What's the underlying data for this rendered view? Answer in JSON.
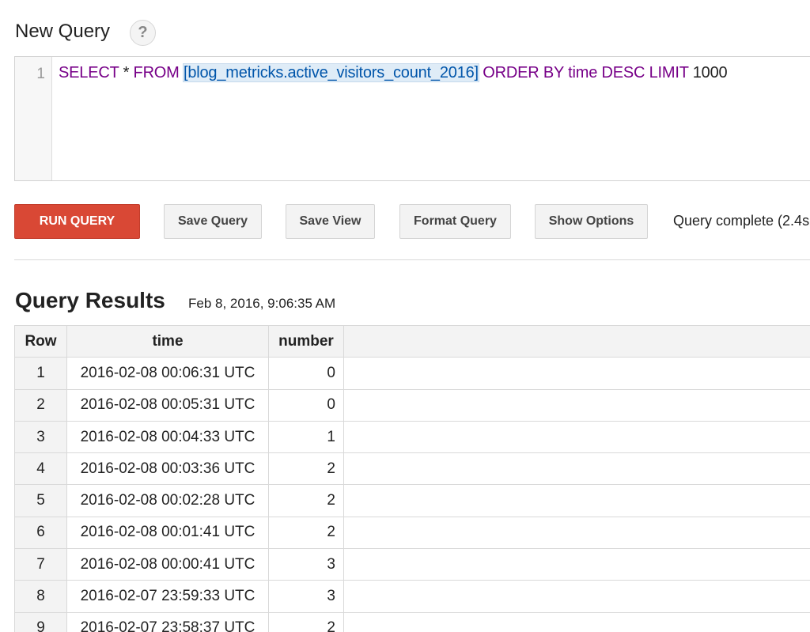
{
  "header": {
    "title": "New Query",
    "help_glyph": "?"
  },
  "editor": {
    "line_number": "1",
    "tokens": {
      "select": "SELECT",
      "star": " * ",
      "from": "FROM",
      "space1": " ",
      "table": "[blog_metricks.active_visitors_count_2016]",
      "space2": " ",
      "order_by": "ORDER BY",
      "space3": " ",
      "time": "time",
      "space4": " ",
      "desc": "DESC",
      "space5": " ",
      "limit": "LIMIT",
      "space6": " ",
      "limit_value": "1000"
    }
  },
  "toolbar": {
    "run_label": "RUN QUERY",
    "save_query_label": "Save Query",
    "save_view_label": "Save View",
    "format_label": "Format Query",
    "options_label": "Show Options",
    "status": "Query complete (2.4s"
  },
  "results": {
    "title": "Query Results",
    "timestamp": "Feb 8, 2016, 9:06:35 AM",
    "columns": {
      "row": "Row",
      "time": "time",
      "number": "number"
    },
    "rows": [
      {
        "row": "1",
        "time": "2016-02-08 00:06:31 UTC",
        "number": "0"
      },
      {
        "row": "2",
        "time": "2016-02-08 00:05:31 UTC",
        "number": "0"
      },
      {
        "row": "3",
        "time": "2016-02-08 00:04:33 UTC",
        "number": "1"
      },
      {
        "row": "4",
        "time": "2016-02-08 00:03:36 UTC",
        "number": "2"
      },
      {
        "row": "5",
        "time": "2016-02-08 00:02:28 UTC",
        "number": "2"
      },
      {
        "row": "6",
        "time": "2016-02-08 00:01:41 UTC",
        "number": "2"
      },
      {
        "row": "7",
        "time": "2016-02-08 00:00:41 UTC",
        "number": "3"
      },
      {
        "row": "8",
        "time": "2016-02-07 23:59:33 UTC",
        "number": "3"
      },
      {
        "row": "9",
        "time": "2016-02-07 23:58:37 UTC",
        "number": "2"
      }
    ]
  },
  "colors": {
    "run_button": "#d94835",
    "keyword": "#770088",
    "table_ref": "#0055aa"
  }
}
